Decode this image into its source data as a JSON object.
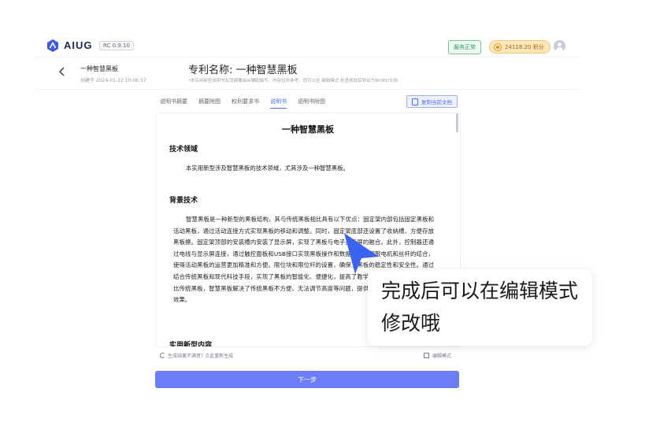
{
  "app": {
    "brand": "AIUG",
    "version": "RC 0.9.10",
    "status": "服务正常",
    "points": "24118.20 积分"
  },
  "header": {
    "doc_name": "一种智慧黑板",
    "created": "创建于 2024-01-22 10:06:37",
    "title": "专利名称:  一种智慧黑板",
    "note": "*本实用新型说明书及其摘要由AI辅助撰写，内容仅供参考，您可以在 编辑模式 检查修改后导出为WORD文档"
  },
  "tabs": [
    "说明书摘要",
    "摘要附图",
    "权利要求书",
    "说明书",
    "说明书附图"
  ],
  "active_tab": "说明书",
  "copy_button": "复制当前文档",
  "document": {
    "title": "一种智慧黑板",
    "section1": "技术领域",
    "para1": "本实用新型涉及智慧黑板的技术领域，尤其涉及一种智慧黑板。",
    "section2": "背景技术",
    "para2": "智慧黑板是一种新型的黑板结构，其与传统黑板相比具有以下优点：固定架内部包括固定黑板和活动黑板，通过活动连接方式实现黑板的移动和调整。同时，固定架底部还设置了收纳槽，方便存放黑板擦。固定架顶部的安装槽内安装了显示屏，实现了黑板与电子显示屏的融合。此外，控制器还通过电线与显示屏连接，通过触控面板和USB接口实现黑板操作和数据传输。伺服电机和丝杆的结合，使得活动黑板的运营更加精准和方便。限位块和限位杆的设置，确保了黑板的稳定性和安全性。通过结合传统黑板和现代科技手段，实现了黑板的智能化、便捷化，提高了教学和学习的效果和体验。相比传统黑板，智慧黑板解决了传统黑板不方便、无法调节高度等问题，提供了更好的用户体验和教学效果。",
    "section3": "实用新型内容"
  },
  "footer": {
    "regen": "生成结果不满意? 点此重新生成",
    "edit_mode": "编辑模式",
    "next": "下一步"
  },
  "callout": {
    "text": "完成后可以在编辑模式修改哦"
  },
  "colors": {
    "accent": "#4a6cf0",
    "button": "#6d7df7",
    "status_green": "#26a05a",
    "pointer": "#3b63f2"
  }
}
